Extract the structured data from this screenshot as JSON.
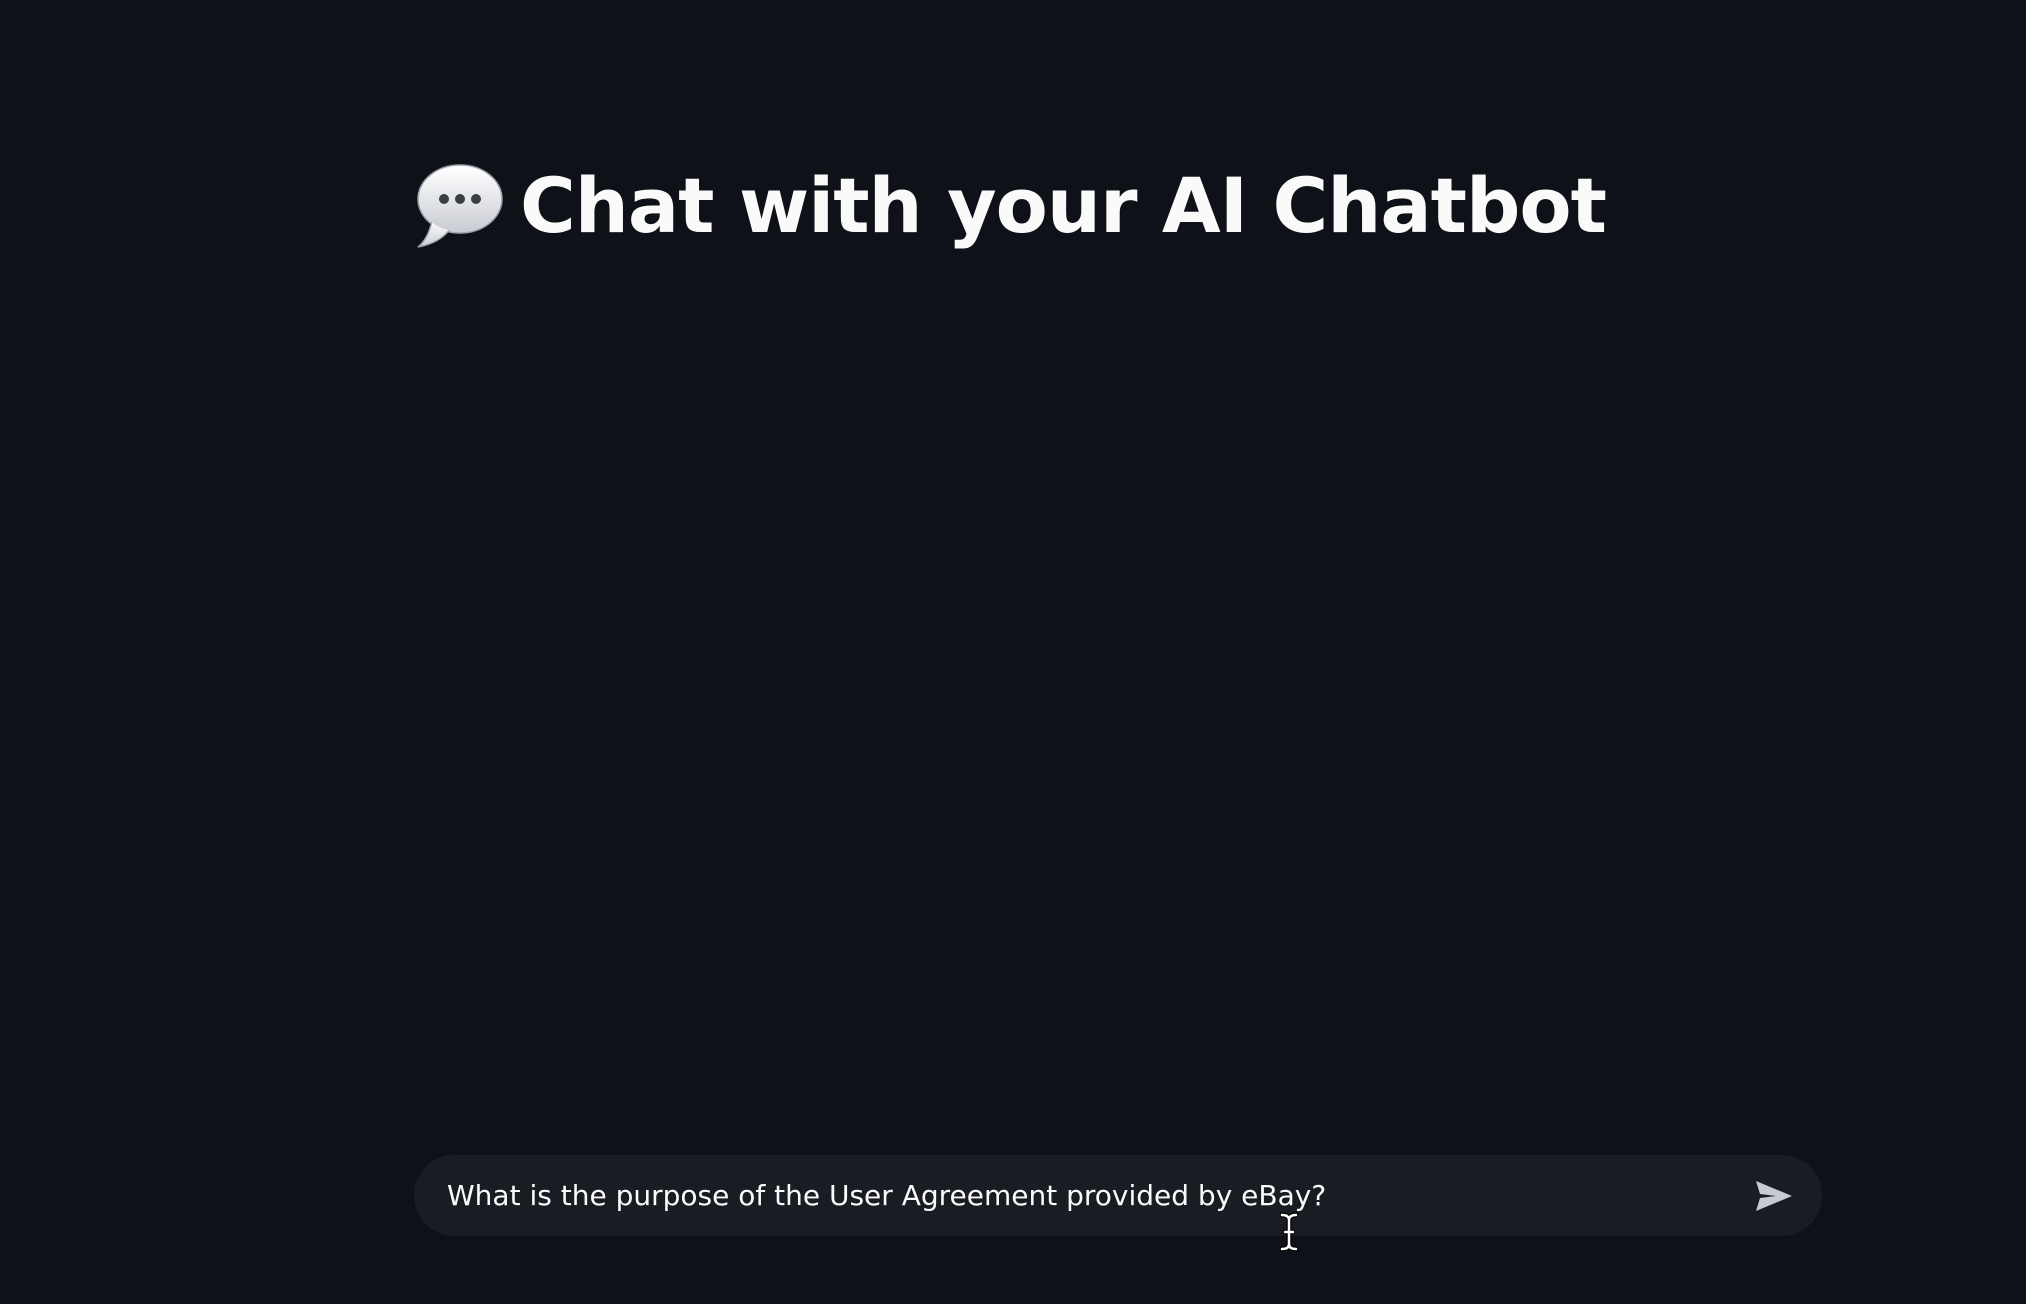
{
  "page": {
    "title": "Chat with your AI Chatbot",
    "title_icon": "speech-balloon-icon"
  },
  "chat_input": {
    "value": "What is the purpose of the User Agreement provided by eBay?",
    "placeholder": "",
    "send_icon": "send-arrow-icon"
  },
  "colors": {
    "background": "#0e1117",
    "input_background": "#1a1c24",
    "text": "#fafafa",
    "icon": "#c9cad1"
  }
}
